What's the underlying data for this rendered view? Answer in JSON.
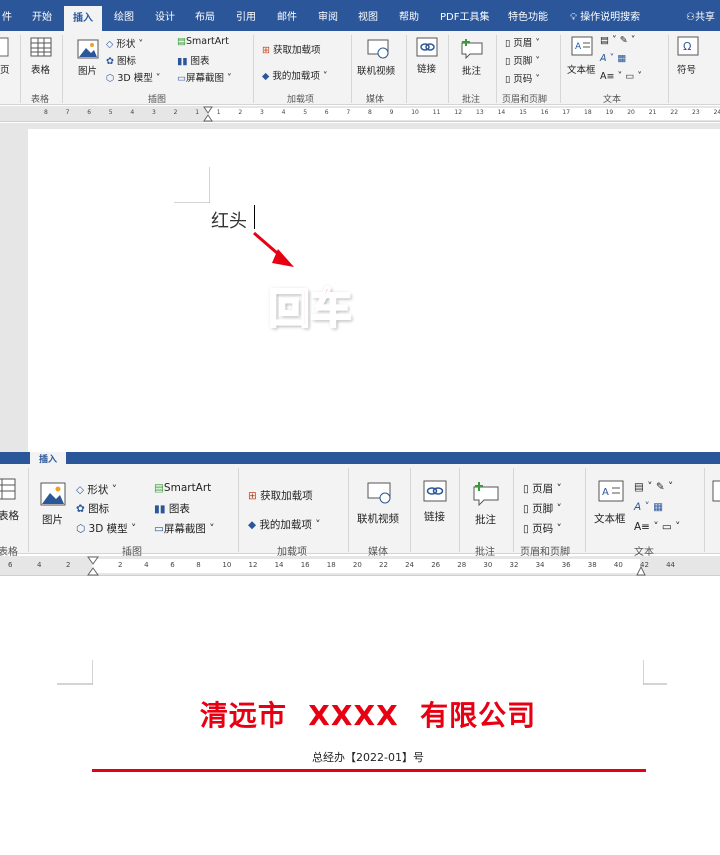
{
  "ribbon": {
    "tabs": [
      "件",
      "开始",
      "插入",
      "绘图",
      "设计",
      "布局",
      "引用",
      "邮件",
      "审阅",
      "视图",
      "帮助",
      "PDF工具集",
      "特色功能"
    ],
    "active_tab": "插入",
    "tell_me": "操作说明搜索",
    "share": "共享",
    "groups": {
      "page_short": "页",
      "table_label": "表格",
      "table_group": "表格",
      "picture": "图片",
      "shapes": "形状",
      "icons": "图标",
      "model3d": "3D 模型",
      "smartart": "SmartArt",
      "chart": "图表",
      "screenshot": "屏幕截图",
      "illustrations": "插图",
      "get_addins": "获取加载项",
      "my_addins": "我的加载项",
      "addins": "加载项",
      "online_video": "联机视频",
      "media": "媒体",
      "link": "链接",
      "comment": "批注",
      "comments": "批注",
      "header": "页眉",
      "footer": "页脚",
      "page_number": "页码",
      "header_footer": "页眉和页脚",
      "textbox": "文本框",
      "text": "文本",
      "symbol": "符号"
    }
  },
  "top_ruler": {
    "ticks": [
      "8",
      "7",
      "6",
      "5",
      "4",
      "3",
      "2",
      "1",
      "1",
      "2",
      "3",
      "4",
      "5",
      "6",
      "7",
      "8",
      "9",
      "10",
      "11",
      "12",
      "13",
      "14",
      "15",
      "16",
      "17",
      "18",
      "19",
      "20",
      "21",
      "22",
      "23",
      "24"
    ]
  },
  "bottom_ruler": {
    "ticks": [
      "6",
      "4",
      "2",
      "2",
      "4",
      "6",
      "8",
      "10",
      "12",
      "14",
      "16",
      "18",
      "20",
      "22",
      "24",
      "26",
      "28",
      "30",
      "32",
      "34",
      "36",
      "38",
      "40",
      "42",
      "44"
    ]
  },
  "document_top": {
    "typed_text": "红头",
    "annotation": "回车"
  },
  "document_bottom": {
    "company_title": "清远市  XXXX  有限公司",
    "doc_number": "总经办【2022-01】号",
    "rule_color": "#e60012"
  },
  "colors": {
    "word_blue": "#2b579a",
    "accent_red": "#e60012"
  }
}
